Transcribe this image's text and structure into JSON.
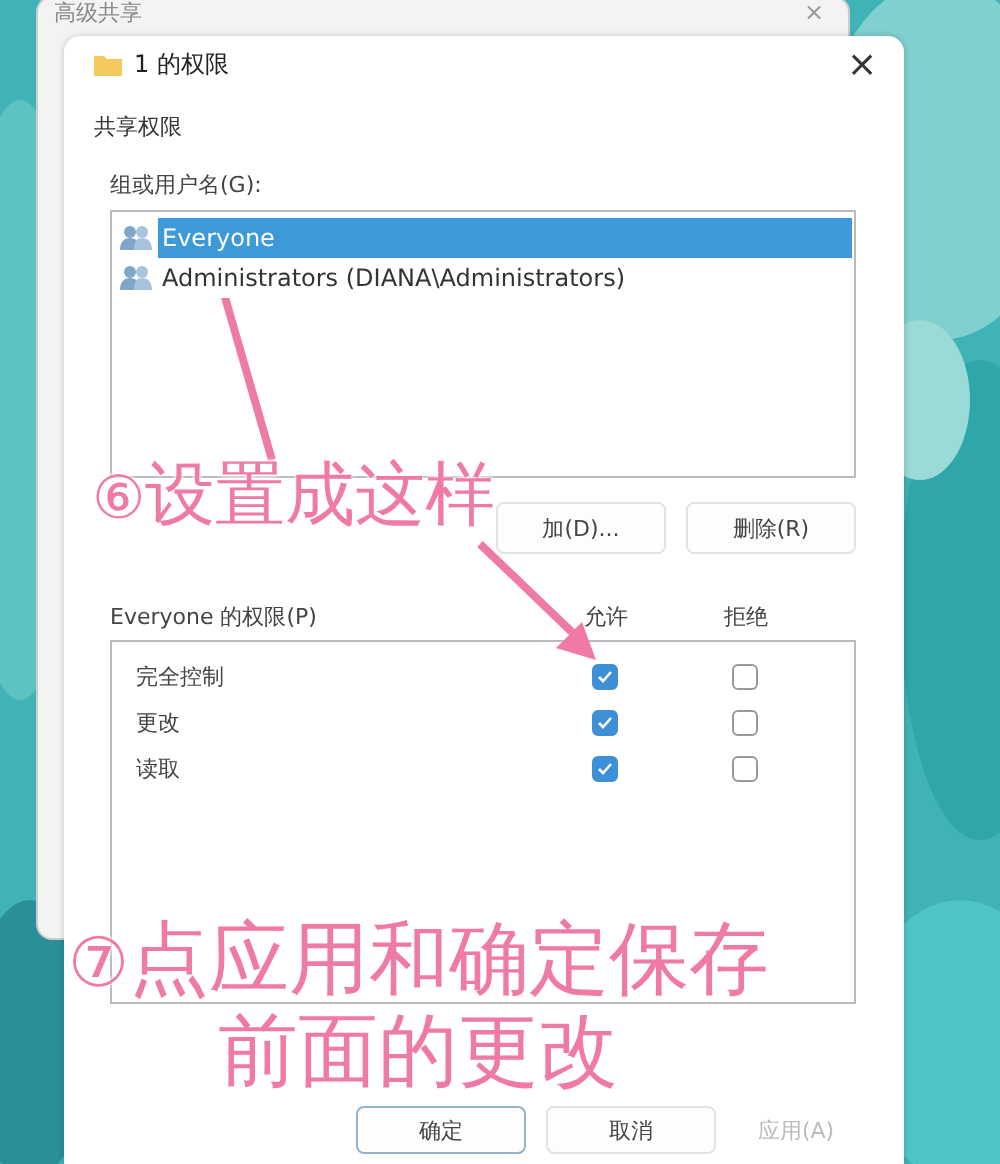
{
  "back_window": {
    "title": "高级共享",
    "close": "×"
  },
  "window": {
    "title": "1 的权限",
    "close": "×"
  },
  "section_title": "共享权限",
  "users_label": "组或用户名(G):",
  "users": [
    {
      "name": "Everyone",
      "selected": true
    },
    {
      "name": "Administrators (DIANA\\Administrators)",
      "selected": false
    }
  ],
  "user_buttons": [
    "加(D)...",
    "删除(R)"
  ],
  "permissions": {
    "title": "Everyone 的权限(P)",
    "columns": [
      "允许",
      "拒绝"
    ],
    "rows": [
      {
        "name": "完全控制",
        "allow": true,
        "deny": false
      },
      {
        "name": "更改",
        "allow": true,
        "deny": false
      },
      {
        "name": "读取",
        "allow": true,
        "deny": false
      }
    ]
  },
  "buttons": [
    {
      "label": "确定",
      "kind": "default",
      "disabled": false
    },
    {
      "label": "取消",
      "kind": "normal",
      "disabled": false
    },
    {
      "label": "应用(A)",
      "kind": "normal",
      "disabled": true
    }
  ],
  "annotations": [
    {
      "kind": "step",
      "number": "⑥",
      "lines": [
        "设置成这样"
      ]
    },
    {
      "kind": "step",
      "number": "⑦",
      "lines": [
        "点应用和确定保存",
        "前面的更改"
      ]
    }
  ]
}
